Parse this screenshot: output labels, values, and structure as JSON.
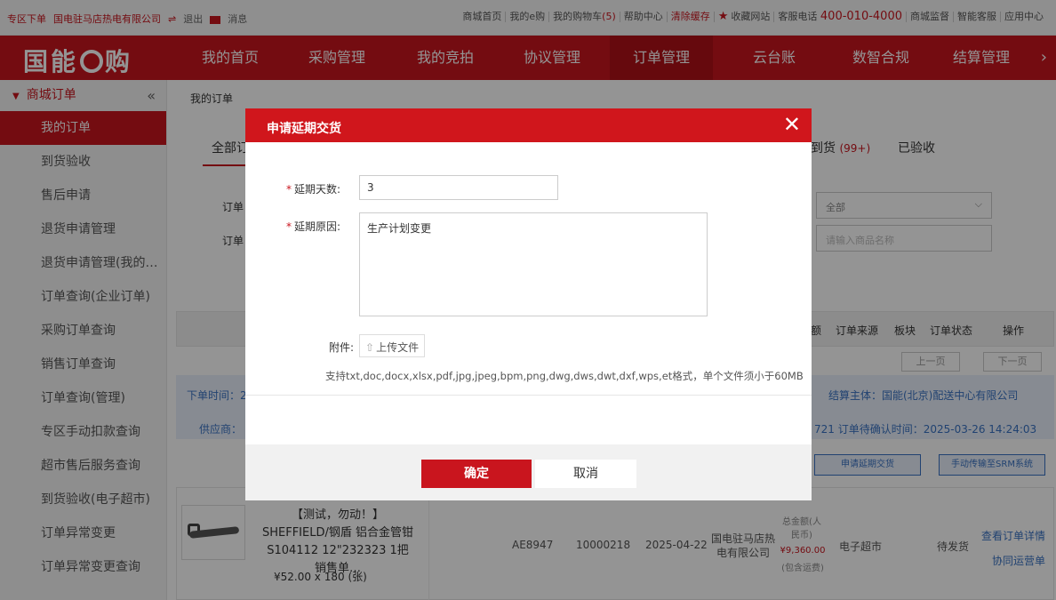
{
  "topbar": {
    "zone": "专区下单",
    "shop": "国电驻马店热电有限公司",
    "logout": "退出",
    "messages": "消息",
    "links": [
      "商城首页",
      "我的e购",
      "我的购物车(5)",
      "帮助中心",
      "清除缓存",
      "收藏网站",
      "客服电话"
    ],
    "phone": "400-010-4000",
    "links2": [
      "商城监督",
      "智能客服",
      "应用中心"
    ]
  },
  "nav": {
    "logo_left": "国能",
    "logo_right": "购",
    "items": [
      "我的首页",
      "采购管理",
      "我的竞拍",
      "协议管理",
      "订单管理",
      "云台账",
      "数智合规",
      "结算管理"
    ],
    "active": "订单管理"
  },
  "sidebar": {
    "title": "商城订单",
    "collapse": "«",
    "items": [
      "我的订单",
      "到货验收",
      "售后申请",
      "退货申请管理",
      "退货申请管理(我的…",
      "订单查询(企业订单)",
      "采购订单查询",
      "销售订单查询",
      "订单查询(管理)",
      "专区手动扣款查询",
      "超市售后服务查询",
      "到货验收(电子超市)",
      "订单异常变更",
      "订单异常变更查询"
    ]
  },
  "main": {
    "breadcrumb": "我的订单",
    "tab_all": "全部订",
    "tab_arrived": "到货",
    "tab_arrived_count": "(99+)",
    "tab_accepted": "已验收",
    "filter_label1": "订单",
    "filter_label2": "订单",
    "select_value": "全部",
    "input_placeholder": "请输入商品名称",
    "headers": [
      "额",
      "订单来源",
      "板块",
      "订单状态",
      "操作"
    ],
    "pager_prev": "上一页",
    "pager_next": "下一页",
    "order_time_label": "下单时间：2",
    "supplier_label": "供应商：",
    "settle_subject": "结算主体：国能(北京)配送中心有限公司",
    "confirm_time": "721 订单待确认时间：2025-03-26 14:24:03",
    "btn_extend": "申请延期交货",
    "btn_srm": "手动传输至SRM系统",
    "row": {
      "name": "【测试，勿动！】SHEFFIELD/钢盾 铝合金管钳 S104112 12\"232323 1把 销售单…",
      "price": "¥52.00  x 180  (张)",
      "code": "AE8947",
      "num": "10000218",
      "date": "2025-04-22",
      "company": "国电驻马店热电有限公司",
      "total_label": "总金额(人民币)",
      "total": "¥9,360.00",
      "shipping": "(包含运费)",
      "source": "电子超市",
      "status": "待发货",
      "action1": "查看订单详情",
      "action2": "协同运营单"
    }
  },
  "dialog": {
    "title": "申请延期交货",
    "close": "✕",
    "days_label": "延期天数:",
    "days_value": "3",
    "reason_label": "延期原因:",
    "reason_value": "生产计划变更",
    "attach_label": "附件:",
    "upload": "上传文件",
    "hint": "支持txt,doc,docx,xlsx,pdf,jpg,jpeg,bpm,png,dwg,dws,dwt,dxf,wps,et格式，单个文件须小于60MB",
    "ok": "确定",
    "cancel": "取消"
  },
  "colors": {
    "brand_red": "#c9151e",
    "link_blue": "#3a73c3"
  }
}
